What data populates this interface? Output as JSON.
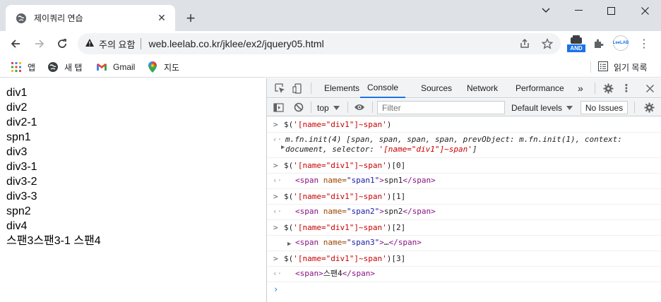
{
  "browser": {
    "tab_title": "제이쿼리 연습",
    "new_tab_label": "+",
    "security_label": "주의 요함",
    "url": "web.leelab.co.kr/jklee/ex2/jquery05.html",
    "extension_badge": "AND",
    "avatar_label": "LeeLAB"
  },
  "bookmarks": {
    "items": [
      {
        "label": "앱",
        "icon": "apps-grid-icon"
      },
      {
        "label": "새 탭",
        "icon": "globe-icon"
      },
      {
        "label": "Gmail",
        "icon": "gmail-icon"
      },
      {
        "label": "지도",
        "icon": "maps-pin-icon"
      }
    ],
    "reading_list": "읽기 목록"
  },
  "page": {
    "lines": [
      "div1",
      "div2",
      "div2-1",
      "spn1",
      "div3",
      "div3-1",
      "div3-2",
      "div3-3",
      "spn2",
      "div4",
      "스팬3스팬3-1 스팬4"
    ]
  },
  "devtools": {
    "tabs": [
      "Elements",
      "Console",
      "Sources",
      "Network",
      "Performance"
    ],
    "active_tab": "Console",
    "more_tabs": "»",
    "context": "top",
    "filter_placeholder": "Filter",
    "levels": "Default levels",
    "issues": "No Issues",
    "console": [
      {
        "cmd_pre": "$(",
        "cmd_str": "'[name=\"div1\"]~span'",
        "cmd_post": ")",
        "result_line1_a": "m.fn.init(4) [span, span, span, span, prevObject: m.fn.init(1), context:",
        "result_line2_a": "document, selector: ",
        "result_line2_str": "'[name=\"div1\"]~span'",
        "result_line2_b": "]"
      },
      {
        "cmd_pre": "$(",
        "cmd_str": "'[name=\"div1\"]~span'",
        "cmd_post": ")[0]",
        "tag_open": "<span",
        "attr_name": " name=",
        "attr_value": "\"span1\"",
        "tag_gt": ">",
        "text": "spn1",
        "tag_close": "</span>"
      },
      {
        "cmd_pre": "$(",
        "cmd_str": "'[name=\"div1\"]~span'",
        "cmd_post": ")[1]",
        "tag_open": "<span",
        "attr_name": " name=",
        "attr_value": "\"span2\"",
        "tag_gt": ">",
        "text": "spn2",
        "tag_close": "</span>"
      },
      {
        "cmd_pre": "$(",
        "cmd_str": "'[name=\"div1\"]~span'",
        "cmd_post": ")[2]",
        "tag_open": "<span",
        "attr_name": " name=",
        "attr_value": "\"span3\"",
        "tag_gt": ">",
        "text": "…",
        "tag_close": "</span>"
      },
      {
        "cmd_pre": "$(",
        "cmd_str": "'[name=\"div1\"]~span'",
        "cmd_post": ")[3]",
        "tag_open": "<span>",
        "text": "스팬4",
        "tag_close": "</span>"
      }
    ]
  },
  "colors": {
    "accent": "#1a73e8",
    "tab_strip": "#dee1e6",
    "devtools_bar": "#f1f3f4"
  }
}
